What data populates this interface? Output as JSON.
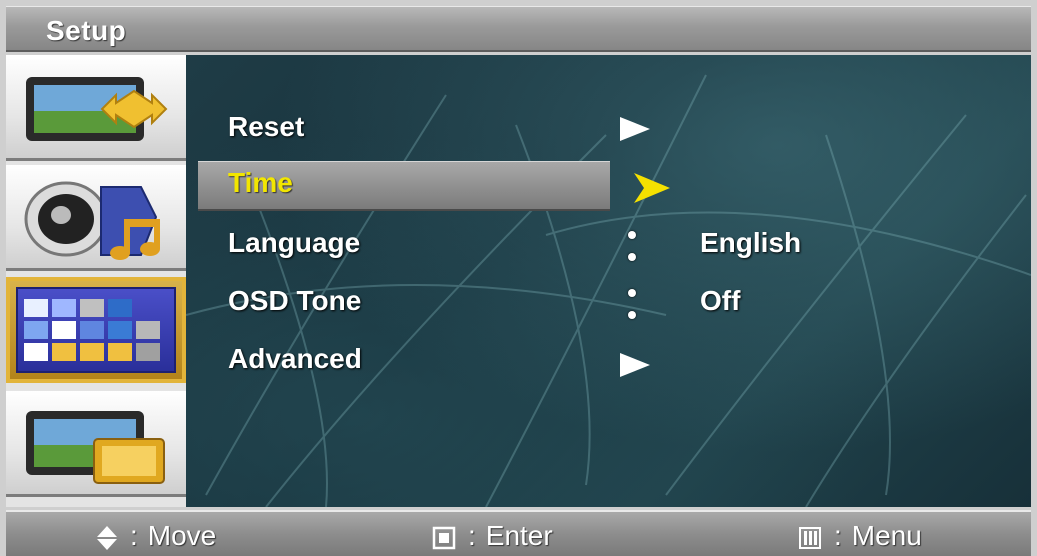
{
  "window": {
    "title": "Setup"
  },
  "sidebar": {
    "items": [
      {
        "name": "picture",
        "icon": "monitor-move-icon",
        "active": false
      },
      {
        "name": "sound",
        "icon": "speaker-music-icon",
        "active": false
      },
      {
        "name": "setup",
        "icon": "setup-grid-icon",
        "active": true
      },
      {
        "name": "input",
        "icon": "monitor-pip-icon",
        "active": false
      }
    ]
  },
  "menu": {
    "items": [
      {
        "label": "Reset",
        "type": "submenu",
        "value": ""
      },
      {
        "label": "Time",
        "type": "submenu",
        "value": "",
        "selected": true
      },
      {
        "label": "Language",
        "type": "value",
        "value": "English"
      },
      {
        "label": "OSD Tone",
        "type": "value",
        "value": "Off"
      },
      {
        "label": "Advanced",
        "type": "submenu",
        "value": ""
      }
    ]
  },
  "footer": {
    "move": {
      "icon": "up-down-arrows-icon",
      "text": "Move"
    },
    "enter": {
      "icon": "enter-square-icon",
      "text": "Enter"
    },
    "menu": {
      "icon": "menu-bars-icon",
      "text": "Menu"
    },
    "separator": ":"
  },
  "colors": {
    "selected_text": "#f2e600",
    "selected_arrow": "#f5e100",
    "text": "#ffffff",
    "active_tab_border": "#e2b43a"
  }
}
